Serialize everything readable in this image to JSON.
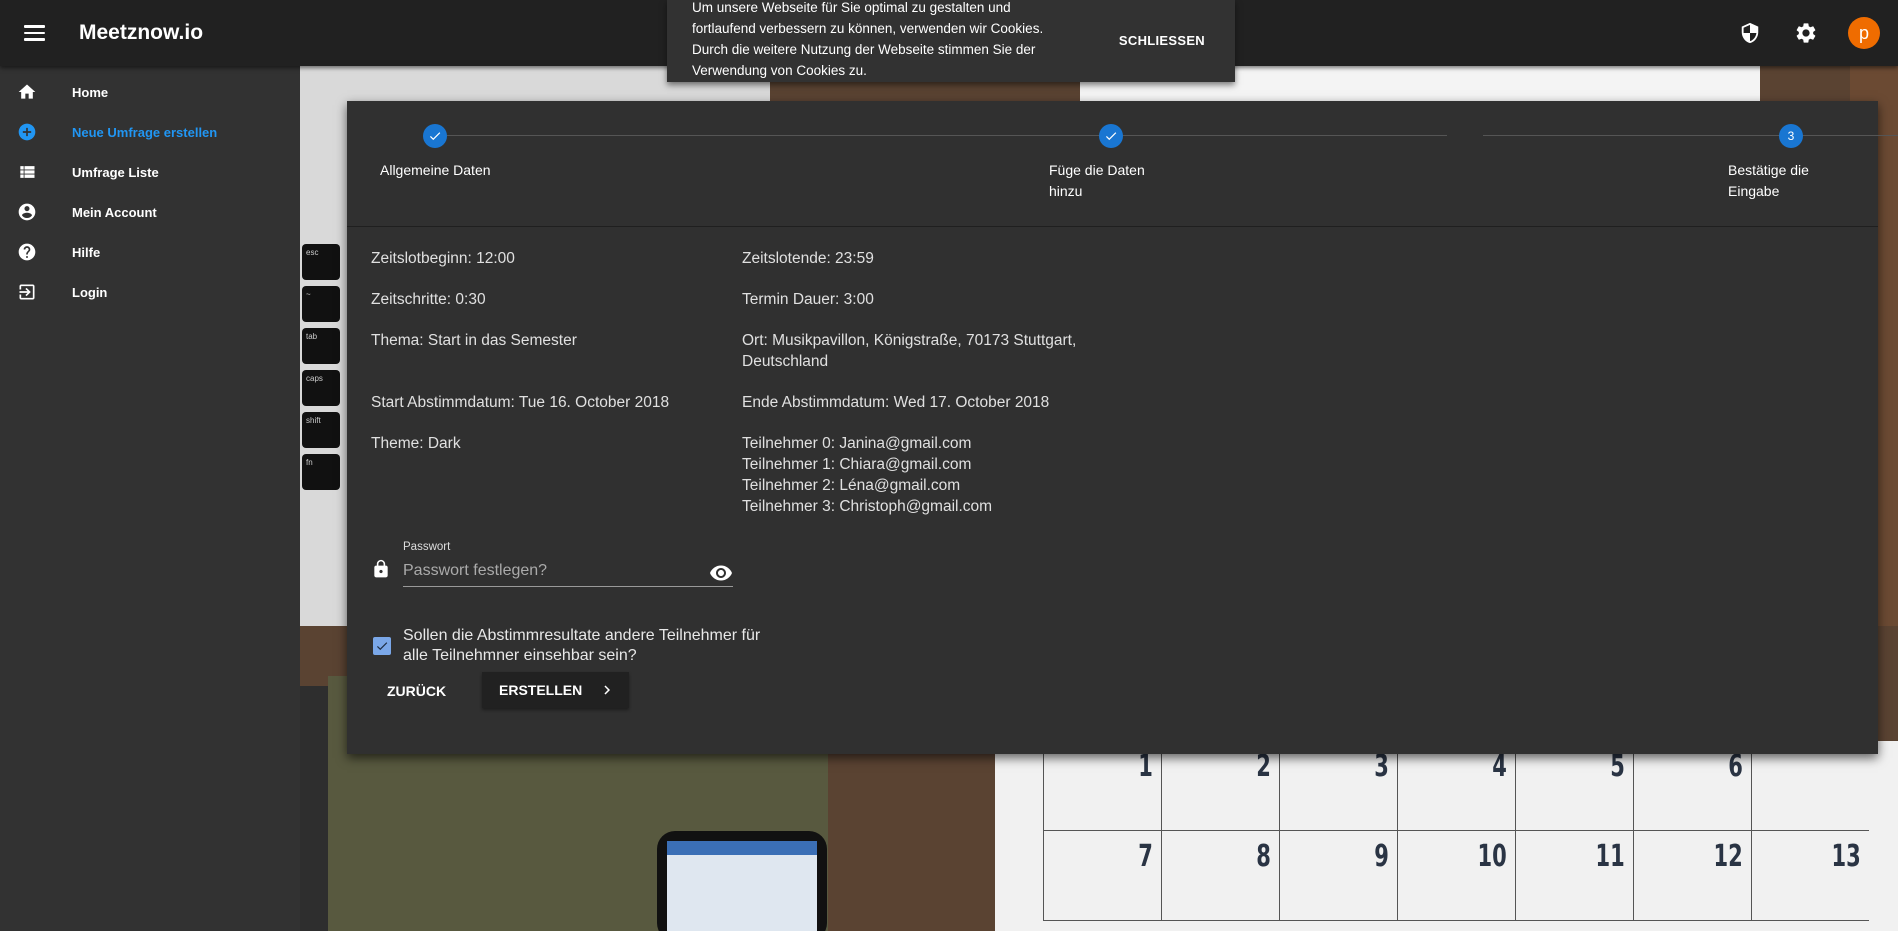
{
  "app": {
    "title": "Meetznow.io",
    "avatar_letter": "p"
  },
  "topbar": {
    "icons": [
      "shield-icon",
      "gear-icon"
    ]
  },
  "cookie": {
    "text": "Um unsere Webseite für Sie optimal zu gestalten und fortlaufend verbessern zu können, verwenden wir Cookies. Durch die weitere Nutzung der Webseite stimmen Sie der Verwendung von Cookies zu.",
    "close_label": "SCHLIESSEN"
  },
  "sidebar": {
    "items": [
      {
        "label": "Home",
        "icon": "home-icon"
      },
      {
        "label": "Neue Umfrage erstellen",
        "icon": "add-circle-icon",
        "active": true
      },
      {
        "label": "Umfrage Liste",
        "icon": "list-icon"
      },
      {
        "label": "Mein Account",
        "icon": "account-circle-icon"
      },
      {
        "label": "Hilfe",
        "icon": "help-icon"
      },
      {
        "label": "Login",
        "icon": "login-icon"
      }
    ]
  },
  "stepper": {
    "steps": [
      {
        "label": "Allgemeine Daten",
        "state": "done"
      },
      {
        "label": "Füge die Daten hinzu",
        "state": "done"
      },
      {
        "label": "Bestätige die Eingabe",
        "state": "active",
        "number": "3"
      }
    ]
  },
  "summary": {
    "zeitslotbeginn": "Zeitslotbeginn: 12:00",
    "zeitslotende": "Zeitslotende: 23:59",
    "zeitschritte": "Zeitschritte: 0:30",
    "termin_dauer": "Termin Dauer: 3:00",
    "thema": "Thema: Start in das Semester",
    "ort": "Ort: Musikpavillon, Königstraße, 70173 Stuttgart, Deutschland",
    "start_abstimm": "Start Abstimmdatum: Tue 16. October 2018",
    "ende_abstimm": "Ende Abstimmdatum: Wed 17. October 2018",
    "theme": "Theme: Dark",
    "teilnehmer": [
      "Teilnehmer 0: Janina@gmail.com",
      "Teilnehmer 1: Chiara@gmail.com",
      "Teilnehmer 2: Léna@gmail.com",
      "Teilnehmer 3: Christoph@gmail.com"
    ]
  },
  "password": {
    "label": "Passwort",
    "placeholder": "Passwort festlegen?",
    "value": ""
  },
  "results_checkbox": {
    "label": "Sollen die Abstimmresultate andere Teilnehmer für alle Teilnehmner einsehbar sein?",
    "checked": true
  },
  "actions": {
    "back_label": "ZURÜCK",
    "create_label": "ERSTELLEN"
  },
  "background_calendar": {
    "days": [
      "1",
      "2",
      "3",
      "4",
      "5",
      "6",
      "7",
      "8",
      "9",
      "10",
      "11",
      "12",
      "13"
    ]
  },
  "colors": {
    "accent": "#2196f3",
    "step": "#1976d2",
    "avatar": "#ef6c00",
    "checkbox": "#7aa7e8"
  }
}
